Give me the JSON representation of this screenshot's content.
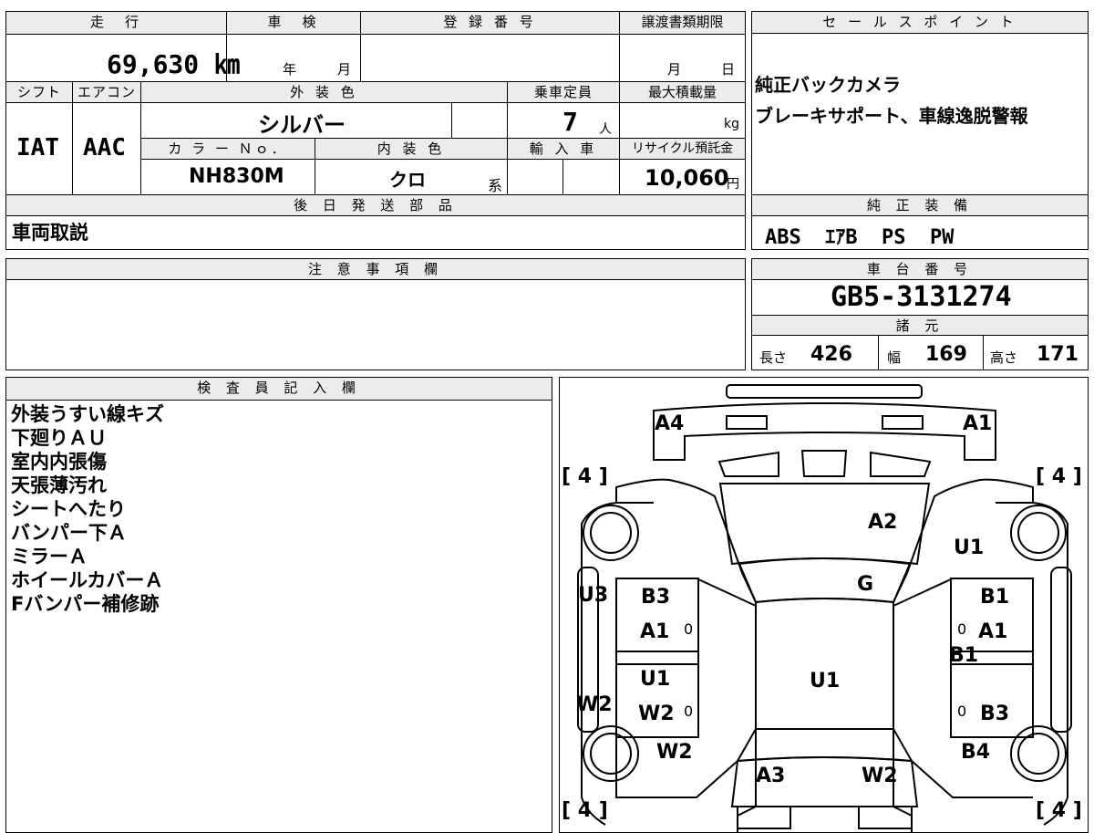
{
  "header": {
    "mileage_label": "走　行",
    "shaken_label": "車　検",
    "registration_label": "登 録 番 号",
    "transfer_deadline_label": "譲渡書類期限",
    "mileage_value": "69,630 ㎞",
    "shaken_year": "年",
    "shaken_month": "月",
    "transfer_month": "月",
    "transfer_day": "日"
  },
  "vehicle": {
    "shift_label": "シフト",
    "ac_label": "エアコン",
    "exterior_color_label": "外 装 色",
    "capacity_label": "乗車定員",
    "max_load_label": "最大積載量",
    "shift_value": "IAT",
    "ac_value": "AAC",
    "exterior_color": "シルバー",
    "capacity_value": "7",
    "capacity_unit": "人",
    "load_unit": "kg",
    "color_no_label": "カ ラ ー Ｎｏ．",
    "interior_color_label": "内 装 色",
    "import_label": "輸 入 車",
    "recycle_label": "リサイクル預託金",
    "color_no_value": "NH830M",
    "interior_color_value": "クロ",
    "interior_suffix": "系",
    "recycle_value": "10,060",
    "recycle_unit": "円"
  },
  "sales_points": {
    "title": "セ ー ル ス ポ イ ン ト",
    "lines": [
      "純正バックカメラ",
      "ブレーキサポート、車線逸脱警報"
    ]
  },
  "later_parts": {
    "title": "後 日 発 送 部 品",
    "value": "車両取説"
  },
  "equipment": {
    "title": "純 正 装 備",
    "value": "ABS  ｴｱB  PS  PW"
  },
  "notes": {
    "title": "注 意 事 項 欄"
  },
  "chassis": {
    "title": "車 台 番 号",
    "value": "GB5-3131274"
  },
  "specs": {
    "title": "諸 元",
    "length_label": "長さ",
    "length_value": "426",
    "width_label": "幅",
    "width_value": "169",
    "height_label": "高さ",
    "height_value": "171"
  },
  "inspector": {
    "title": "検 査 員 記 入 欄",
    "lines": [
      "外装うすい線キズ",
      "下廻りＡＵ",
      "室内内張傷",
      "天張薄汚れ",
      "シートへたり",
      "バンパー下Ａ",
      "ミラーＡ",
      "ホイールカバーＡ",
      "Fバンパー補修跡"
    ]
  },
  "diagram": {
    "labels": {
      "a4": "A4",
      "a1_top": "A1",
      "a2": "A2",
      "u1_hood_right": "U1",
      "g": "G",
      "u3": "U3",
      "b3_left": "B3",
      "a1_left": "A1",
      "u1_left": "U1",
      "w2_left_door": "W2",
      "w2_left_edge": "W2",
      "w2_left_rear": "W2",
      "a3": "A3",
      "w2_rear": "W2",
      "u1_roof": "U1",
      "b1_right": "B1",
      "a1_right": "A1",
      "b1_mid": "B1",
      "b3_right": "B3",
      "b4": "B4"
    },
    "tires": [
      "4",
      "4",
      "4",
      "4"
    ],
    "tread_marks": [
      "0",
      "0",
      "0",
      "0"
    ]
  }
}
